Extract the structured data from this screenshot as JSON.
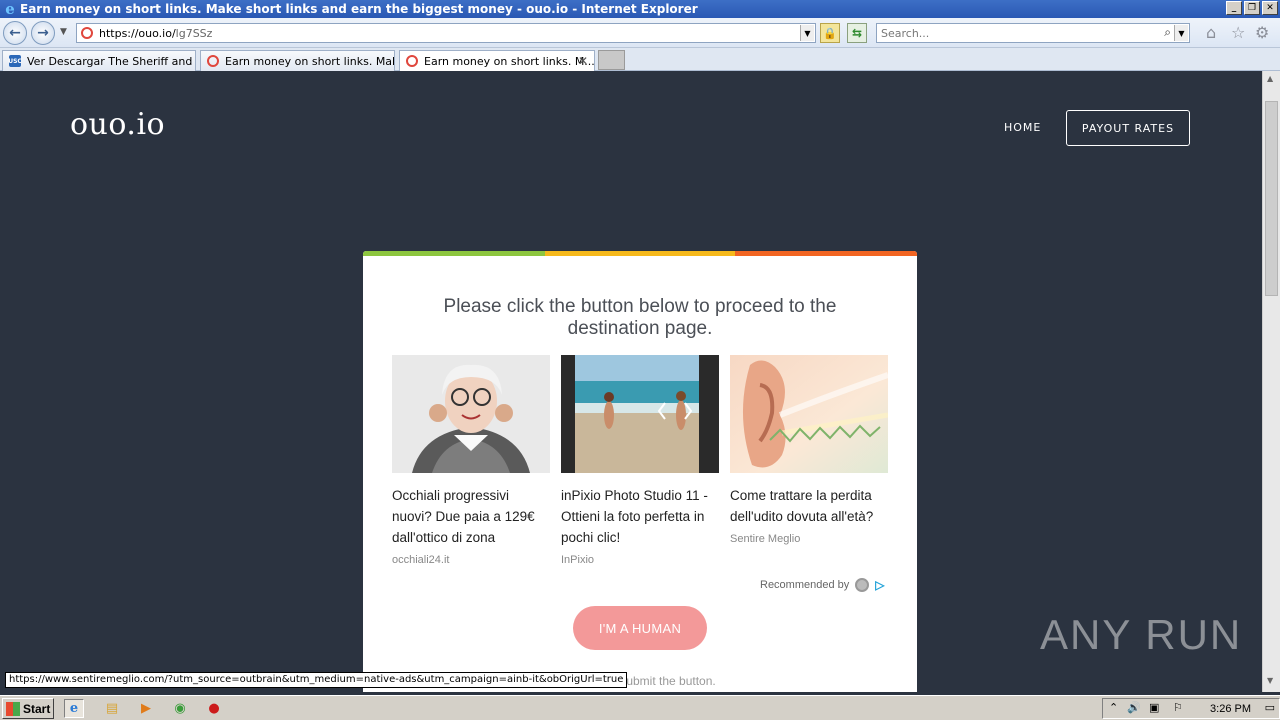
{
  "window": {
    "title": "Earn money on short links. Make short links and earn the biggest money - ouo.io - Internet Explorer",
    "controls": {
      "minimize": "_",
      "restore": "❐",
      "close": "✕"
    }
  },
  "address_bar": {
    "url_host": "https://ouo.io/",
    "url_path": "lg7SSz",
    "search_placeholder": "Search..."
  },
  "tabs": [
    {
      "label": "Ver Descargar The Sheriff and t...",
      "icon": "usc",
      "active": false
    },
    {
      "label": "Earn money on short links. Mak...",
      "icon": "ouo",
      "active": false
    },
    {
      "label": "Earn money on short links. M...",
      "icon": "ouo",
      "active": true
    }
  ],
  "site": {
    "logo": "ouo.io",
    "nav": {
      "home": "HOME",
      "payout": "PAYOUT RATES"
    }
  },
  "card": {
    "accent_colors": [
      "#8dc63f",
      "#f6b91b",
      "#f26522"
    ],
    "heading": "Please click the button below to proceed to the destination page.",
    "ads": [
      {
        "headline": "Occhiali progressivi nuovi? Due paia a 129€ dall'ottico di zona",
        "source": "occhiali24.it"
      },
      {
        "headline": "inPixio Photo Studio 11 - Ottieni la foto perfetta in pochi clic!",
        "source": "InPixio"
      },
      {
        "headline": "Come trattare la perdita dell'udito dovuta all'età?",
        "source": "Sentire Meglio"
      }
    ],
    "recommended_by": "Recommended by",
    "button": "I'M A HUMAN",
    "note": "ou cannot submit the button."
  },
  "status_url": "https://www.sentiremeglio.com/?utm_source=outbrain&utm_medium=native-ads&utm_campaign=ainb-it&obOrigUrl=true",
  "watermark": "ANY RUN",
  "taskbar": {
    "start": "Start",
    "clock": "3:26 PM"
  }
}
